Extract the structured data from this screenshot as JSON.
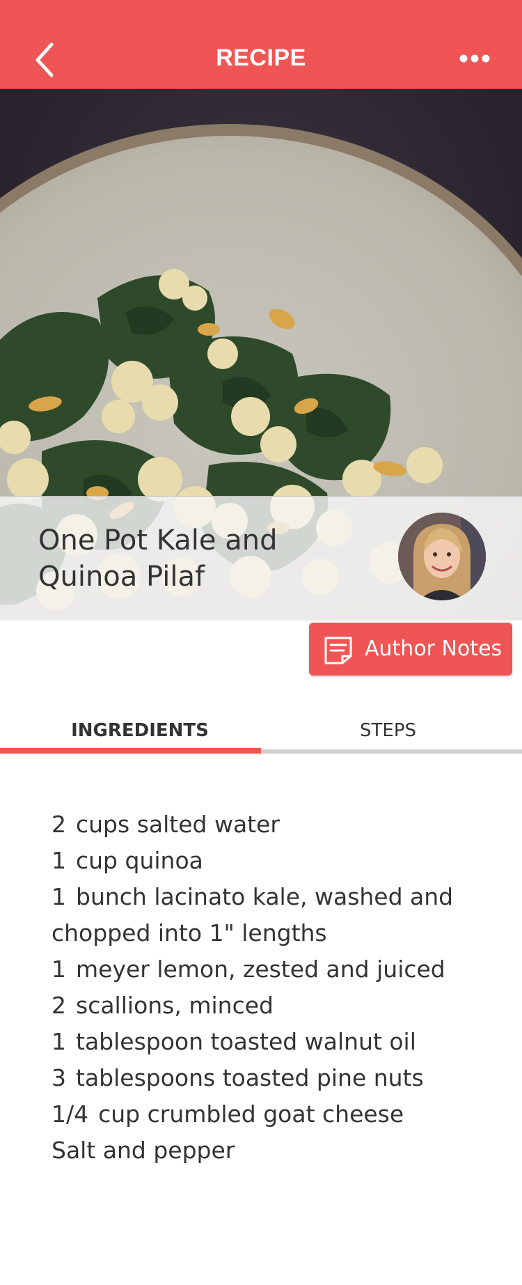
{
  "header": {
    "title": "RECIPE",
    "back_icon": "chevron-left-icon",
    "more_icon": "ellipsis-icon"
  },
  "recipe": {
    "title": "One Pot Kale and Quinoa Pilaf"
  },
  "author_notes": {
    "label": "Author Notes",
    "icon": "note-icon"
  },
  "tabs": [
    {
      "label": "INGREDIENTS",
      "active": true
    },
    {
      "label": "STEPS",
      "active": false
    }
  ],
  "ingredients": [
    {
      "qty": "2",
      "text": "cups salted water"
    },
    {
      "qty": "1",
      "text": "cup quinoa"
    },
    {
      "qty": "1",
      "text": "bunch lacinato kale, washed and chopped into 1\" lengths"
    },
    {
      "qty": "1",
      "text": "meyer lemon, zested and juiced"
    },
    {
      "qty": "2",
      "text": "scallions, minced"
    },
    {
      "qty": "1",
      "text": "tablespoon toasted walnut oil"
    },
    {
      "qty": "3",
      "text": "tablespoons toasted pine nuts"
    },
    {
      "qty": "1/4",
      "text": "cup crumbled goat cheese"
    },
    {
      "qty": "",
      "text": "Salt and pepper"
    }
  ],
  "colors": {
    "accent": "#ef5555",
    "tab_inactive_bar": "#cfcfcf",
    "text": "#333333"
  }
}
